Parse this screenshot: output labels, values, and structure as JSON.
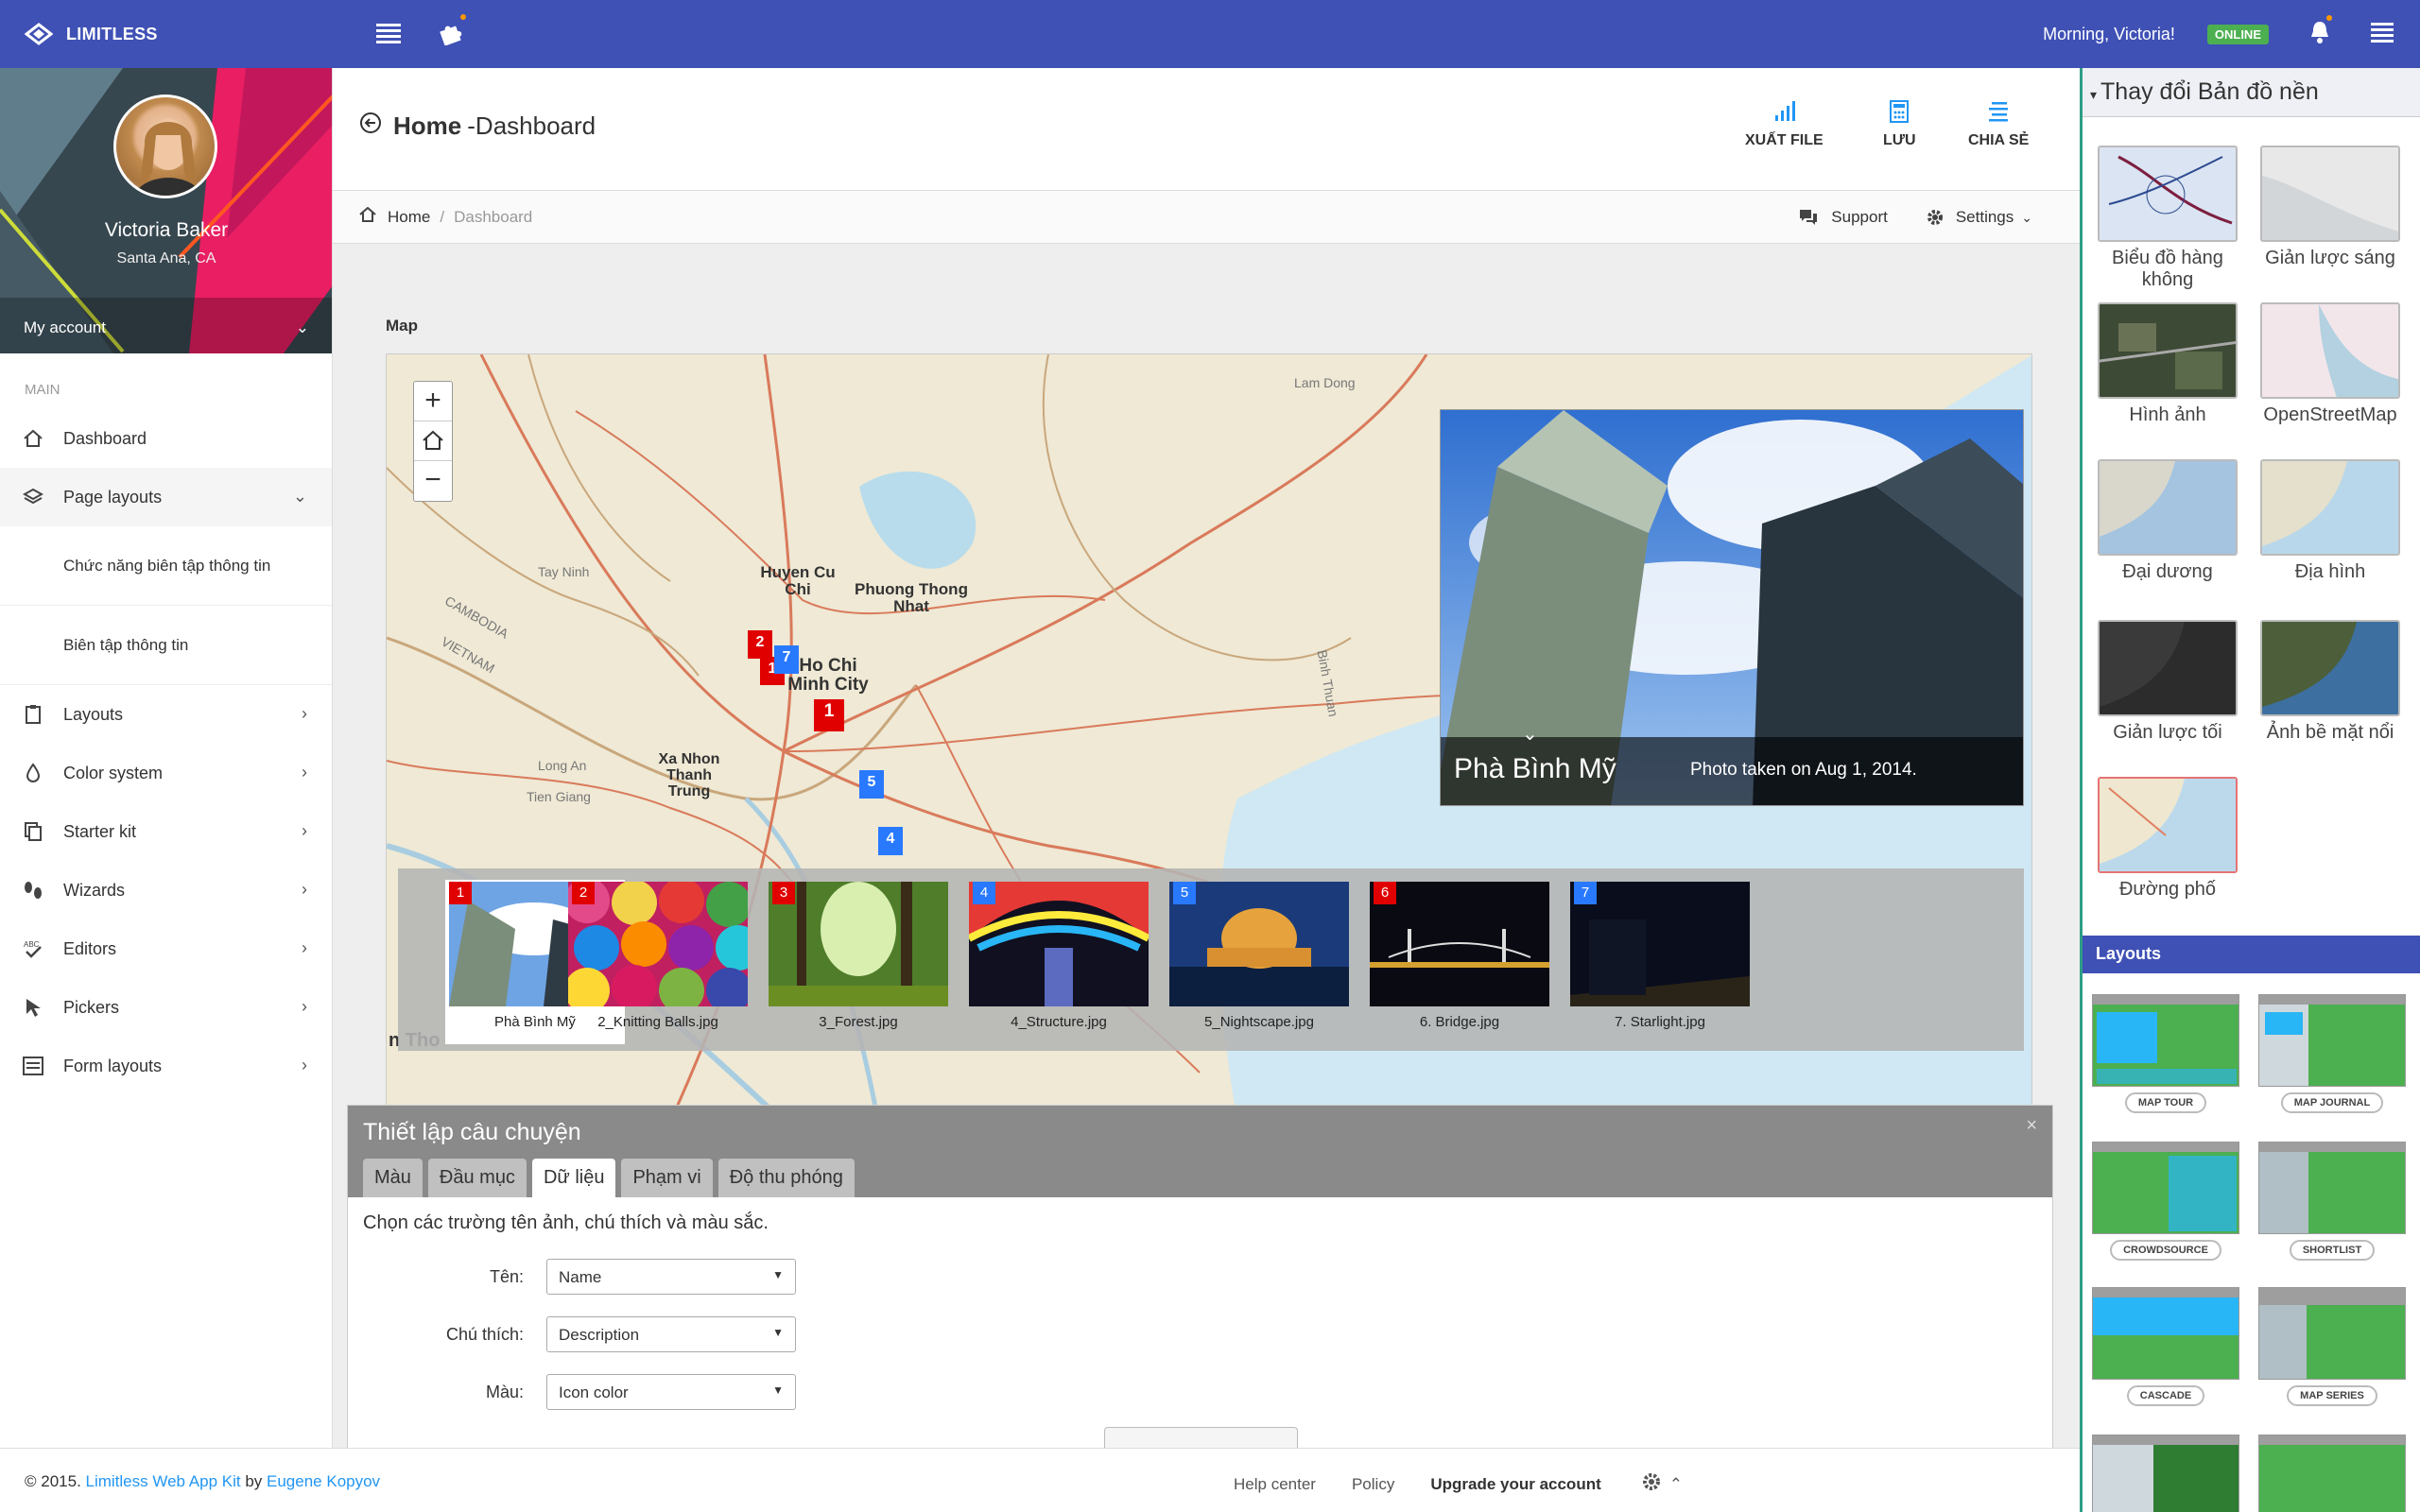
{
  "navbar": {
    "brand": "LIMITLESS",
    "greeting": "Morning, Victoria!",
    "status": "ONLINE"
  },
  "sidebar": {
    "user_name": "Victoria Baker",
    "user_location": "Santa Ana, CA",
    "account_label": "My account",
    "section": "MAIN",
    "items": [
      {
        "label": "Dashboard",
        "icon": "home-icon"
      },
      {
        "label": "Page layouts",
        "icon": "layers-icon"
      },
      {
        "label": "Layouts",
        "icon": "clipboard-icon"
      },
      {
        "label": "Color system",
        "icon": "droplet-icon"
      },
      {
        "label": "Starter kit",
        "icon": "copy-icon"
      },
      {
        "label": "Wizards",
        "icon": "footprints-icon"
      },
      {
        "label": "Editors",
        "icon": "spellcheck-icon"
      },
      {
        "label": "Pickers",
        "icon": "pointer-icon"
      },
      {
        "label": "Form layouts",
        "icon": "form-icon"
      }
    ],
    "subitems": [
      "Chức năng biên tập thông tin",
      "Biên tập thông tin"
    ]
  },
  "header": {
    "title_main": "Home",
    "title_sep": " - ",
    "title_sub": "Dashboard",
    "buttons": [
      "XUẤT FILE",
      "LƯU",
      "CHIA SẺ"
    ]
  },
  "breadcrumb": {
    "home": "Home",
    "sep": "/",
    "current": "Dashboard",
    "support": "Support",
    "settings": "Settings"
  },
  "map": {
    "label": "Map",
    "places": [
      "Huyen Cu Chi",
      "Phuong Thong Nhat",
      "Ho Chi Minh City",
      "Xa Nhon Thanh Trung",
      "CAMBODIA",
      "VIETNAM",
      "Tay Ninh",
      "Long An",
      "Tien Giang",
      "Lam Dong",
      "Binh Thuan",
      "n Tho"
    ],
    "feature": {
      "title": "Phà Bình Mỹ",
      "date": "Photo taken on Aug 1, 2014."
    },
    "thumbs": [
      {
        "num": "1",
        "name": "Phà Bình Mỹ",
        "color": "#e00000"
      },
      {
        "num": "2",
        "name": "2_Knitting Balls.jpg",
        "color": "#e00000"
      },
      {
        "num": "3",
        "name": "3_Forest.jpg",
        "color": "#e00000"
      },
      {
        "num": "4",
        "name": "4_Structure.jpg",
        "color": "#2979ff"
      },
      {
        "num": "5",
        "name": "5_Nightscape.jpg",
        "color": "#2979ff"
      },
      {
        "num": "6",
        "name": "6. Bridge.jpg",
        "color": "#e00000"
      },
      {
        "num": "7",
        "name": "7. Starlight.jpg",
        "color": "#2979ff"
      }
    ],
    "pins": [
      "2",
      "1",
      "7",
      "1",
      "5",
      "4"
    ]
  },
  "story": {
    "title": "Thiết lập câu chuyện",
    "close": "×",
    "tabs": [
      "Màu",
      "Đầu mục",
      "Dữ liệu",
      "Phạm vi",
      "Độ thu phóng"
    ],
    "active_tab": "Dữ liệu",
    "description": "Chọn các trường tên ảnh, chú thích và màu sắc.",
    "fields": [
      {
        "label": "Tên:",
        "value": "Name"
      },
      {
        "label": "Chú thích:",
        "value": "Description"
      },
      {
        "label": "Màu:",
        "value": "Icon color"
      }
    ]
  },
  "footer": {
    "copyright": "© 2015. ",
    "kit": "Limitless Web App Kit",
    "by": " by ",
    "author": "Eugene Kopyov",
    "links": [
      "Help center",
      "Policy",
      "Upgrade your account"
    ]
  },
  "right_panel": {
    "basemap_title": "Thay đổi Bản đồ nền",
    "basemaps": [
      "Biểu đồ hàng không",
      "Giản lược sáng",
      "Hình ảnh",
      "OpenStreetMap",
      "Đại dương",
      "Địa hình",
      "Giản lược tối",
      "Ảnh bề mặt nổi",
      "Đường phố"
    ],
    "layouts_title": "Layouts",
    "layouts": [
      "MAP TOUR",
      "MAP JOURNAL",
      "CROWDSOURCE",
      "SHORTLIST",
      "CASCADE",
      "MAP SERIES"
    ]
  }
}
